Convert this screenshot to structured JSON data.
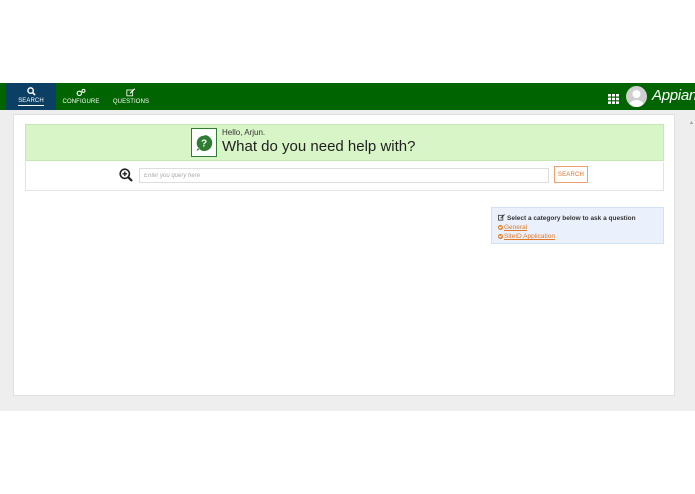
{
  "nav": {
    "tabs": [
      {
        "label": "SEARCH",
        "icon": "search-icon",
        "active": true
      },
      {
        "label": "CONFIGURE",
        "icon": "gears-icon",
        "active": false
      },
      {
        "label": "QUESTIONS",
        "icon": "edit-icon",
        "active": false
      }
    ],
    "brand": "Appian"
  },
  "hero": {
    "greeting": "Hello, Arjun.",
    "title": "What do you need help with?"
  },
  "search": {
    "placeholder": "Enter you query here",
    "button_label": "SEARCH"
  },
  "categories": {
    "heading": "Select a category below to ask a question",
    "items": [
      "General",
      "SiteID Application"
    ]
  },
  "colors": {
    "topbar": "#006400",
    "active_tab": "#0b3f63",
    "hero_bg": "#d7f5c7",
    "accent_orange": "#e07a2a",
    "category_bg": "#eaf1fc"
  }
}
